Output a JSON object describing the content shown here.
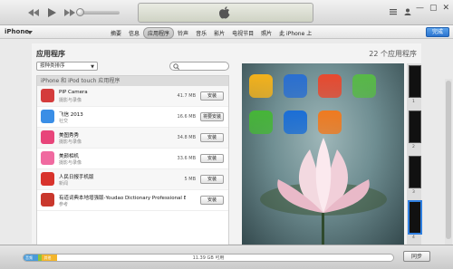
{
  "window": {
    "minimize": "—",
    "maximize": "▢",
    "close": "✕"
  },
  "navbar": {
    "device_name": "iPhone",
    "tabs": [
      "摘要",
      "信息",
      "应用程序",
      "铃声",
      "音乐",
      "影片",
      "电视节目",
      "照片",
      "此 iPhone 上"
    ],
    "active_tab": "应用程序",
    "done_label": "完成"
  },
  "apps_panel": {
    "title": "应用程序",
    "count": "22 个应用程序",
    "sort_label": "按种类排序",
    "search_placeholder": "",
    "list_header": "iPhone 和 iPod touch 应用程序",
    "apps": [
      {
        "name": "PIP Camera",
        "category": "摄影与录像",
        "size": "41.7 MB",
        "button": "安装",
        "color": "#d43c3c"
      },
      {
        "name": "飞信 2013",
        "category": "社交",
        "size": "16.6 MB",
        "button": "将要安装",
        "color": "#3a8ee6"
      },
      {
        "name": "美图秀秀",
        "category": "摄影与录像",
        "size": "34.8 MB",
        "button": "安装",
        "color": "#e8457a"
      },
      {
        "name": "美颜相机",
        "category": "摄影与录像",
        "size": "33.6 MB",
        "button": "安装",
        "color": "#f06aa0"
      },
      {
        "name": "人民日报手机版",
        "category": "新闻",
        "size": "5 MB",
        "button": "安装",
        "color": "#d8332c"
      },
      {
        "name": "有道词典本地增强版-Youdao Dictionary Professional E...",
        "category": "参考",
        "size": "",
        "button": "安装",
        "color": "#c9372c"
      }
    ]
  },
  "home_screen": {
    "icons": [
      {
        "label": "",
        "color": "#f4b21b",
        "icon": "star-icon"
      },
      {
        "label": "",
        "color": "#2a6fd1",
        "icon": "qq-icon"
      },
      {
        "label": "",
        "color": "#e8492f",
        "icon": "mail-icon"
      },
      {
        "label": "",
        "color": "#58b947",
        "icon": "chart-icon"
      },
      {
        "label": "",
        "color": "#46b538",
        "icon": "wechat-icon"
      },
      {
        "label": "",
        "color": "#1b6ed6",
        "icon": "clip-icon"
      },
      {
        "label": "",
        "color": "#f07a1f",
        "icon": "lens-icon"
      }
    ],
    "pages": [
      "1",
      "2",
      "3",
      "4"
    ],
    "selected_page": "4"
  },
  "capacity": {
    "segments": [
      {
        "label": "音频",
        "color": "#4a9bd8",
        "fraction": 0.04
      },
      {
        "label": "",
        "color": "#8fc43a",
        "fraction": 0.01
      },
      {
        "label": "其他",
        "color": "#f3b52c",
        "fraction": 0.04
      }
    ],
    "free_text": "11.39 GB 可用",
    "sync_label": "同步"
  }
}
